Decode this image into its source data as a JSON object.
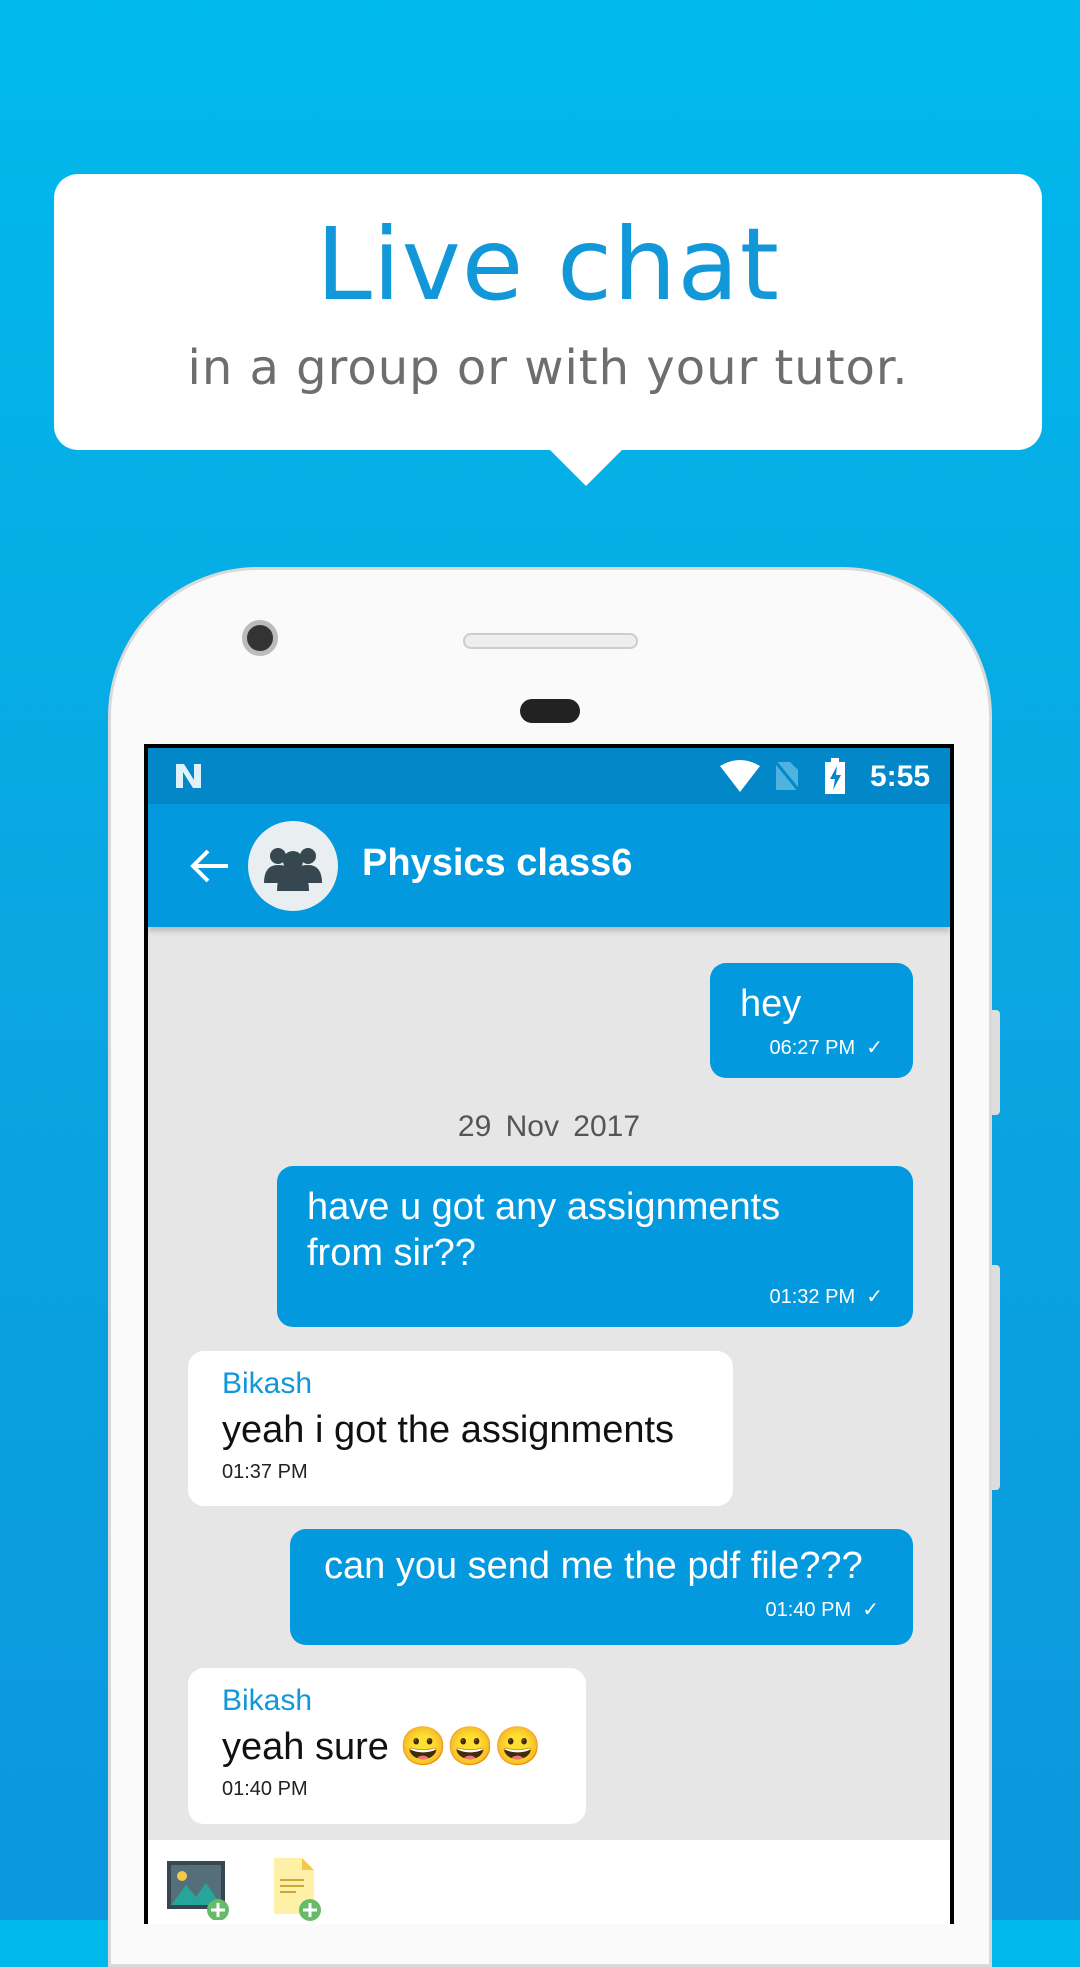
{
  "promo": {
    "title": "Live chat",
    "subtitle": "in a group or with your tutor."
  },
  "status_bar": {
    "time": "5:55",
    "icons": [
      "n-logo-icon",
      "wifi-icon",
      "no-sim-icon",
      "battery-charging-icon"
    ]
  },
  "app_bar": {
    "title": "Physics class6",
    "back_icon": "arrow-left-icon",
    "avatar_icon": "group-icon"
  },
  "messages": [
    {
      "direction": "out",
      "text": "hey",
      "time": "06:27 PM",
      "status": "sent"
    },
    {
      "type": "date",
      "text": "29  Nov  2017"
    },
    {
      "direction": "out",
      "text": "have u got any assignments from sir??",
      "time": "01:32 PM",
      "status": "sent"
    },
    {
      "direction": "in",
      "sender": "Bikash",
      "text": "yeah i got the assignments",
      "time": "01:37 PM"
    },
    {
      "direction": "out",
      "text": "can you send me the pdf file???",
      "time": "01:40 PM",
      "status": "sent"
    },
    {
      "direction": "in",
      "sender": "Bikash",
      "text": "yeah sure 😀😀😀",
      "time": "01:40 PM"
    }
  ],
  "input_bar": {
    "icons": [
      "add-image-icon",
      "add-document-icon"
    ]
  },
  "colors": {
    "primary": "#0399de",
    "status": "#0288c8",
    "chat_bg": "#e6e6e6",
    "accent": "#1297d8"
  }
}
